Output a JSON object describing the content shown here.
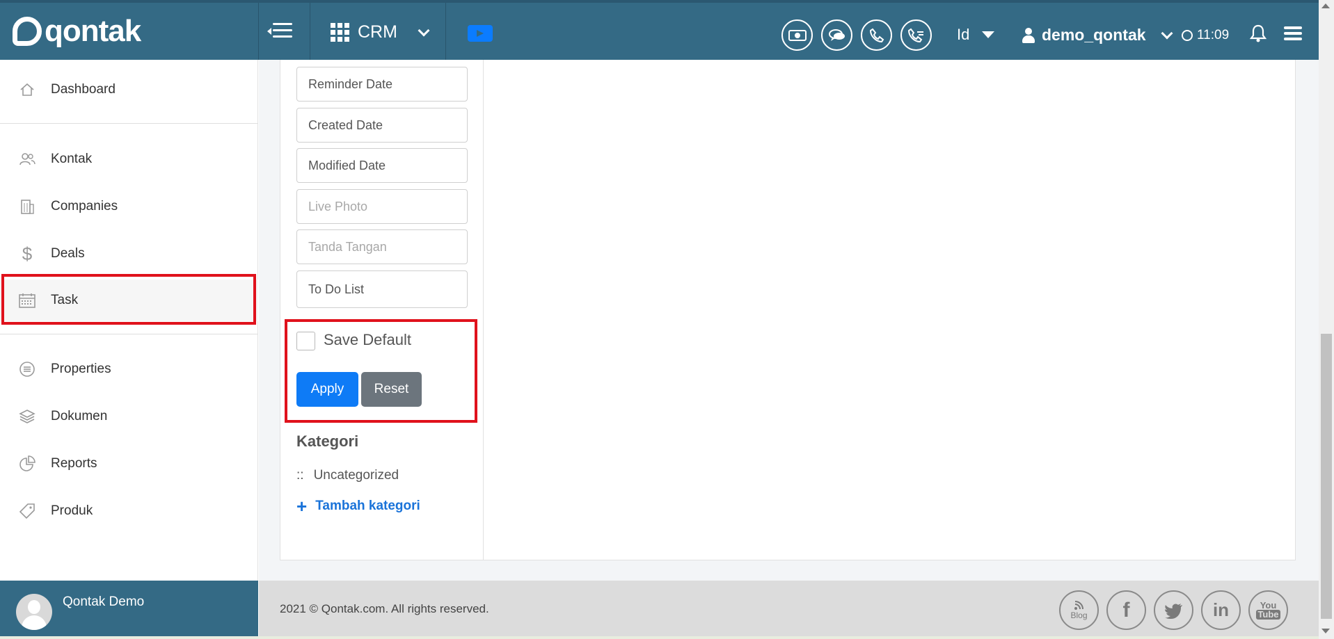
{
  "header": {
    "logo_text": "qontak",
    "app_switcher": "CRM",
    "language": "Id",
    "username": "demo_qontak",
    "time": "11:09"
  },
  "sidebar": {
    "items": [
      {
        "label": "Dashboard",
        "icon": "home-icon"
      },
      {
        "label": "Kontak",
        "icon": "users-icon"
      },
      {
        "label": "Companies",
        "icon": "building-icon"
      },
      {
        "label": "Deals",
        "icon": "dollar-icon"
      },
      {
        "label": "Task",
        "icon": "calendar-icon",
        "active": true
      },
      {
        "label": "Properties",
        "icon": "list-circle-icon"
      },
      {
        "label": "Dokumen",
        "icon": "layers-icon"
      },
      {
        "label": "Reports",
        "icon": "pie-chart-icon"
      },
      {
        "label": "Produk",
        "icon": "tag-icon"
      }
    ],
    "profile_name": "Qontak Demo"
  },
  "filter": {
    "fields": [
      {
        "label": "Reminder Date",
        "muted": false
      },
      {
        "label": "Created Date",
        "muted": false
      },
      {
        "label": "Modified Date",
        "muted": false
      },
      {
        "label": "Live Photo",
        "muted": true
      },
      {
        "label": "Tanda Tangan",
        "muted": true
      },
      {
        "label": "To Do List",
        "muted": false
      }
    ],
    "save_default_label": "Save Default",
    "save_default_checked": false,
    "apply_label": "Apply",
    "reset_label": "Reset"
  },
  "kategori": {
    "title": "Kategori",
    "item_prefix": "::",
    "item": "Uncategorized",
    "add_label": "Tambah kategori"
  },
  "footer": {
    "copyright": "2021 © Qontak.com. All rights reserved.",
    "blog_label": "Blog",
    "social": [
      "blog-icon",
      "facebook-icon",
      "twitter-icon",
      "linkedin-icon",
      "youtube-icon"
    ]
  },
  "colors": {
    "header": "#346a85",
    "apply": "#0e7bf6",
    "reset": "#6c757d",
    "highlight": "#e0121c",
    "link": "#1a73d9"
  }
}
